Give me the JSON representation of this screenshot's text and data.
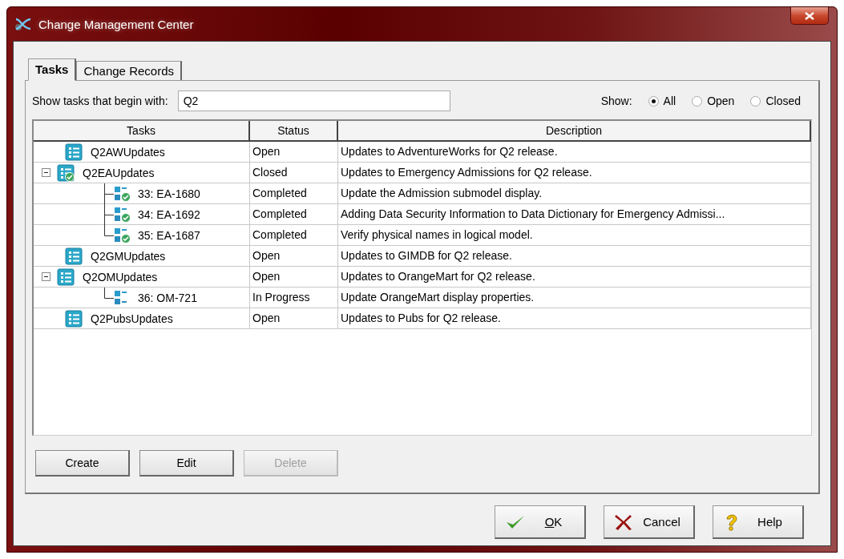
{
  "window": {
    "title": "Change Management Center"
  },
  "tabs": [
    {
      "label": "Tasks",
      "selected": true
    },
    {
      "label": "Change Records",
      "selected": false
    }
  ],
  "filter": {
    "label": "Show tasks that begin with:",
    "value": "Q2"
  },
  "show": {
    "label": "Show:",
    "options": [
      {
        "label": "All",
        "selected": true
      },
      {
        "label": "Open",
        "selected": false
      },
      {
        "label": "Closed",
        "selected": false
      }
    ]
  },
  "table": {
    "columns": [
      "Tasks",
      "Status",
      "Description"
    ],
    "rows": [
      {
        "name": "Q2AWUpdates",
        "status": "Open",
        "description": "Updates to AdventureWorks for Q2 release.",
        "kind": "task"
      },
      {
        "name": "Q2EAUpdates",
        "status": "Closed",
        "description": "Updates to Emergency Admissions for Q2 release.",
        "kind": "task-done",
        "expanded": true,
        "children": [
          {
            "name": "33: EA-1680",
            "status": "Completed",
            "description": "Update the Admission submodel display.",
            "kind": "item-done"
          },
          {
            "name": "34: EA-1692",
            "status": "Completed",
            "description": "Adding Data Security Information to Data Dictionary for Emergency Admissi...",
            "kind": "item-done"
          },
          {
            "name": "35: EA-1687",
            "status": "Completed",
            "description": "Verify physical names in logical model.",
            "kind": "item-done"
          }
        ]
      },
      {
        "name": "Q2GMUpdates",
        "status": "Open",
        "description": "Updates to GIMDB for Q2 release.",
        "kind": "task"
      },
      {
        "name": "Q2OMUpdates",
        "status": "Open",
        "description": "Updates to OrangeMart for Q2 release.",
        "kind": "task",
        "expanded": true,
        "children": [
          {
            "name": "36: OM-721",
            "status": "In Progress",
            "description": "Update OrangeMart display properties.",
            "kind": "item"
          }
        ]
      },
      {
        "name": "Q2PubsUpdates",
        "status": "Open",
        "description": "Updates to Pubs for Q2 release.",
        "kind": "task"
      }
    ]
  },
  "actions": [
    {
      "label": "Create",
      "disabled": false
    },
    {
      "label": "Edit",
      "disabled": false
    },
    {
      "label": "Delete",
      "disabled": true
    }
  ],
  "buttons": [
    {
      "label": "OK",
      "kind": "ok"
    },
    {
      "label": "Cancel",
      "kind": "cancel"
    },
    {
      "label": "Help",
      "kind": "help"
    }
  ]
}
